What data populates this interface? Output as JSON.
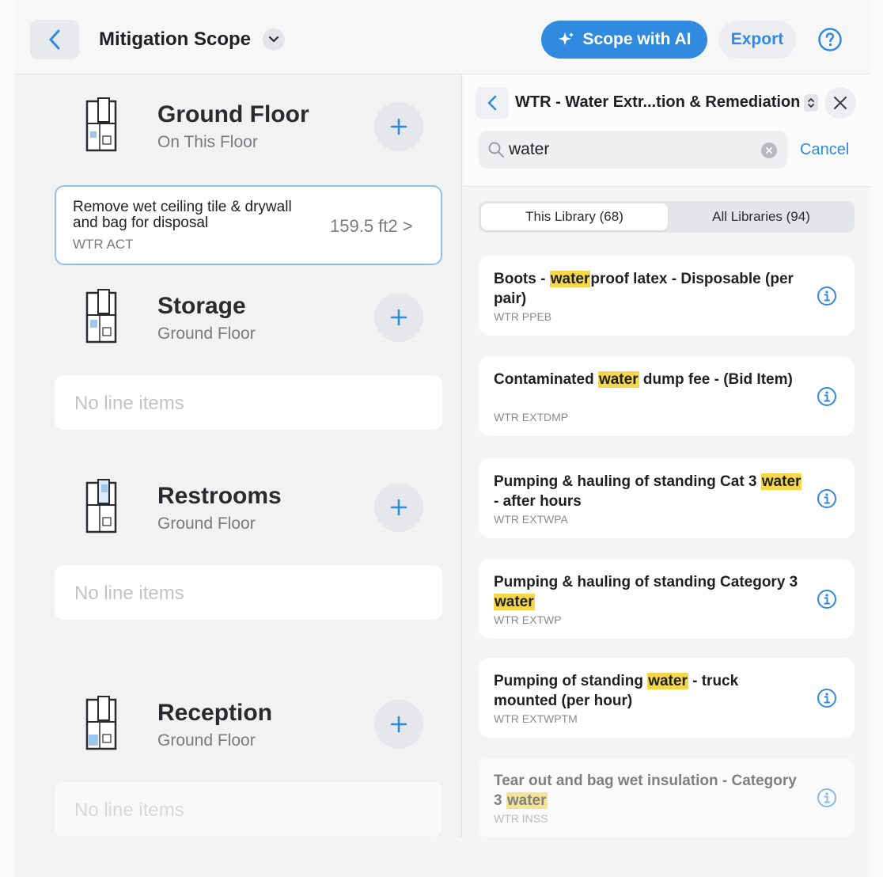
{
  "header": {
    "title": "Mitigation Scope",
    "ai_button": "Scope with AI",
    "export_button": "Export"
  },
  "rooms": [
    {
      "name": "Ground Floor",
      "subtitle": "On This Floor"
    },
    {
      "name": "Storage",
      "subtitle": "Ground Floor"
    },
    {
      "name": "Restrooms",
      "subtitle": "Ground Floor"
    },
    {
      "name": "Reception",
      "subtitle": "Ground Floor"
    }
  ],
  "line_item": {
    "description": "Remove wet ceiling tile & drywall and bag for disposal",
    "code": "WTR ACT",
    "quantity": "159.5 ft2 >"
  },
  "empty_label": "No line items",
  "library": {
    "title": "WTR - Water Extr...tion & Remediation",
    "search_value": "water",
    "cancel": "Cancel",
    "tabs": [
      "This Library (68)",
      "All Libraries (94)"
    ],
    "results": [
      {
        "pre": "Boots - ",
        "hl": "water",
        "post": "proof latex - Disposable (per pair)",
        "code": "WTR PPEB"
      },
      {
        "pre": "Contaminated ",
        "hl": "water",
        "post": " dump fee - (Bid Item)",
        "code": "WTR EXTDMP"
      },
      {
        "pre": "Pumping & hauling of standing Cat 3 ",
        "hl": "water",
        "post": " - after hours",
        "code": "WTR EXTWPA"
      },
      {
        "pre": "Pumping & hauling of standing Category 3 ",
        "hl": "water",
        "post": "",
        "code": "WTR EXTWP"
      },
      {
        "pre": "Pumping of standing ",
        "hl": "water",
        "post": " - truck mounted (per hour)",
        "code": "WTR EXTWPTM"
      },
      {
        "pre": "Tear out and bag wet insulation - Category 3 ",
        "hl": "water",
        "post": "",
        "code": "WTR INSS"
      }
    ]
  },
  "colors": {
    "accent": "#2f8ae0",
    "highlight": "#f7d74a"
  }
}
